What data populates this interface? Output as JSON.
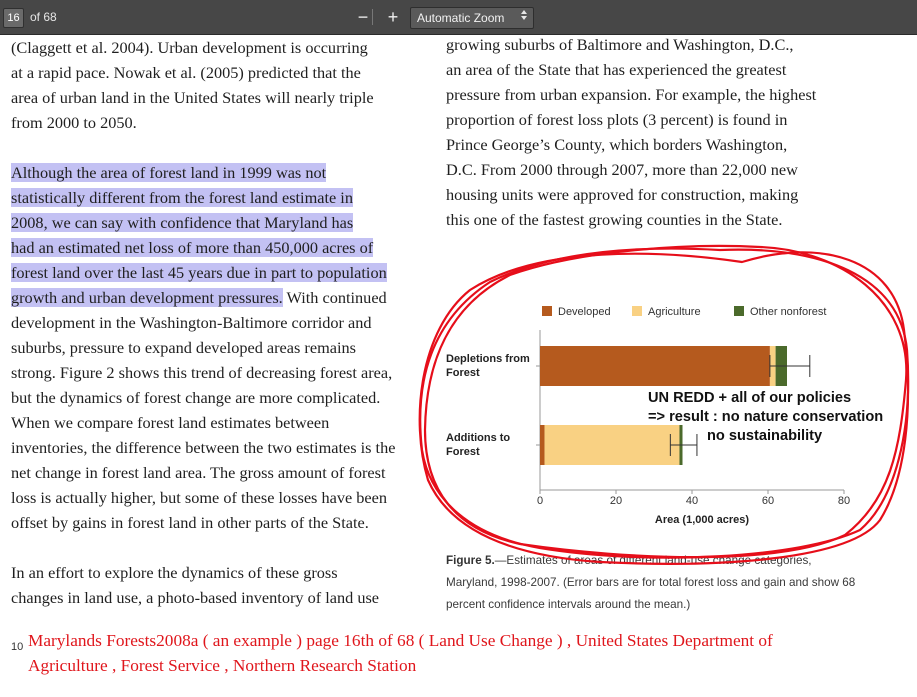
{
  "toolbar": {
    "page_number": "16",
    "page_of": "of 68",
    "zoom_out": "−",
    "zoom_in": "+",
    "zoom_value": "Automatic Zoom",
    "zoom_caret": "▲▼"
  },
  "left_column": {
    "para1": [
      "(Claggett et al. 2004). Urban development is occurring",
      "at a rapid pace. Nowak et al. (2005) predicted that the",
      "area of urban land in the United States will nearly triple",
      "from 2000 to 2050."
    ],
    "para2_highlighted": [
      "Although the area of forest land in 1999 was not",
      "statistically different from the forest land estimate in",
      "2008, we can say with confidence that Maryland has",
      "had an estimated net loss of more than 450,000 acres of",
      "forest land over the last 45 years due in part to population",
      "growth and urban development pressures."
    ],
    "para2_rest_first": " With continued",
    "para2_rest": [
      "development in the Washington-Baltimore corridor and",
      "suburbs, pressure to expand developed areas remains",
      "strong. Figure 2 shows this trend of decreasing forest area,",
      "but the dynamics of forest change are more complicated.",
      "When we compare forest land estimates between",
      "inventories, the difference between the two estimates is the",
      "net change in forest land area. The gross amount of forest",
      "loss is actually higher, but some of these losses have been",
      "offset by gains in forest land in other parts of the State."
    ],
    "para3": [
      "In an effort to explore the dynamics of these gross",
      "changes in land use, a photo-based inventory of land use"
    ]
  },
  "right_column": {
    "lines": [
      "growing suburbs of Baltimore and Washington, D.C.,",
      "an area of the State that has experienced the greatest",
      "pressure from urban expansion. For example, the highest",
      "proportion of forest loss plots (3 percent) is found in",
      "Prince George’s County, which borders Washington,",
      "D.C. From 2000 through 2007, more than 22,000 new",
      "housing units were approved for construction, making",
      "this one of the fastest growing counties in the State."
    ]
  },
  "chart_data": {
    "type": "bar",
    "orientation": "horizontal",
    "stacked": true,
    "categories": [
      "Depletions from Forest",
      "Additions to Forest"
    ],
    "category_label_lines": [
      [
        "Depletions from",
        "Forest"
      ],
      [
        "Additions to",
        "Forest"
      ]
    ],
    "series": [
      {
        "name": "Developed",
        "color": "#b55a1e",
        "values": [
          60.5,
          1.2
        ]
      },
      {
        "name": "Agriculture",
        "color": "#f9d183",
        "values": [
          1.5,
          35.5
        ]
      },
      {
        "name": "Other nonforest",
        "color": "#4b6a2b",
        "values": [
          3.0,
          0.8
        ]
      }
    ],
    "error_bars": [
      {
        "category": "Depletions from Forest",
        "center": 65.0,
        "low": 60.5,
        "high": 71.0
      },
      {
        "category": "Additions to Forest",
        "center": 37.5,
        "low": 34.3,
        "high": 41.3
      }
    ],
    "xlim": [
      0,
      80
    ],
    "xticks": [
      0,
      20,
      40,
      60,
      80
    ],
    "xlabel": "Area (1,000 acres)",
    "legend_position": "top"
  },
  "figure_caption": {
    "label": "Figure 5.",
    "lines": [
      "—Estimates of areas of different land-use change categories,",
      "Maryland, 1998-2007. (Error bars are for total forest loss and gain and show 68",
      "percent confidence intervals around the mean.)"
    ]
  },
  "annotation": {
    "lines": [
      "UN REDD + all of our policies",
      "=> result : no nature conservation",
      "no sustainability"
    ],
    "color": "#e60e1a"
  },
  "footer": {
    "page_num": "10",
    "caption_lines": [
      "Marylands Forests2008a ( an example ) page 16th of 68 ( Land Use Change ) , United States Department of",
      "Agriculture , Forest Service , Northern Research Station"
    ],
    "color": "#e0161c"
  }
}
